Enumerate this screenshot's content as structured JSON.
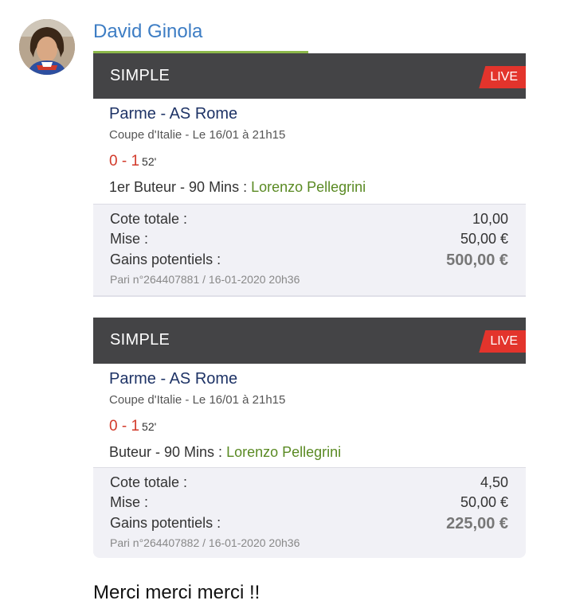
{
  "author": {
    "name": "David Ginola"
  },
  "message": "Merci merci merci !!",
  "colors": {
    "author": "#3d7dc4",
    "header": "#444446",
    "live": "#e3342c",
    "score": "#d23a2a",
    "player": "#5a8a23",
    "progress": "#8cb84a"
  },
  "tickets": [
    {
      "type": "SIMPLE",
      "status": "LIVE",
      "progress_fraction": 0.5,
      "match": "Parme - AS Rome",
      "competition": "Coupe d'Italie - Le 16/01 à 21h15",
      "score": "0 - 1",
      "minute": "52'",
      "bet_label": "1er Buteur - 90 Mins :",
      "bet_selection": "Lorenzo Pellegrini",
      "odds_label": "Cote totale :",
      "odds_value": "10,00",
      "stake_label": "Mise :",
      "stake_value": "50,00 €",
      "gains_label": "Gains potentiels :",
      "gains_value": "500,00 €",
      "ref": "Pari n°264407881 / 16-01-2020 20h36"
    },
    {
      "type": "SIMPLE",
      "status": "LIVE",
      "match": "Parme - AS Rome",
      "competition": "Coupe d'Italie - Le 16/01 à 21h15",
      "score": "0 - 1",
      "minute": "52'",
      "bet_label": "Buteur - 90 Mins :",
      "bet_selection": "Lorenzo Pellegrini",
      "odds_label": "Cote totale :",
      "odds_value": "4,50",
      "stake_label": "Mise :",
      "stake_value": "50,00 €",
      "gains_label": "Gains potentiels :",
      "gains_value": "225,00 €",
      "ref": "Pari n°264407882 / 16-01-2020 20h36"
    }
  ]
}
